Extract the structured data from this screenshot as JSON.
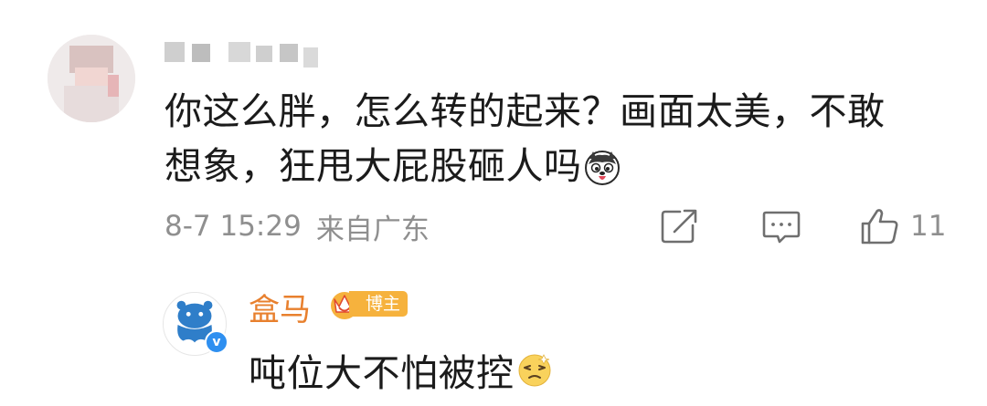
{
  "comment": {
    "text_line1": "你这么胖，怎么转的起来？画面太美，不敢",
    "text_line2": "想象，狂甩大屁股砸人吗",
    "emoji": "husky-emoji-icon",
    "time": "8-7 15:29",
    "location": "来自广东",
    "like_count": "11"
  },
  "reply": {
    "username": "盒马",
    "badge": "博主",
    "text": "吨位大不怕被控",
    "emoji": "dizzy-face-emoji-icon"
  },
  "colors": {
    "reply_username": "#e8802e",
    "badge_bg": "#f6b23d",
    "verified": "#2e8ff0",
    "meta_gray": "#8f8f8f"
  }
}
